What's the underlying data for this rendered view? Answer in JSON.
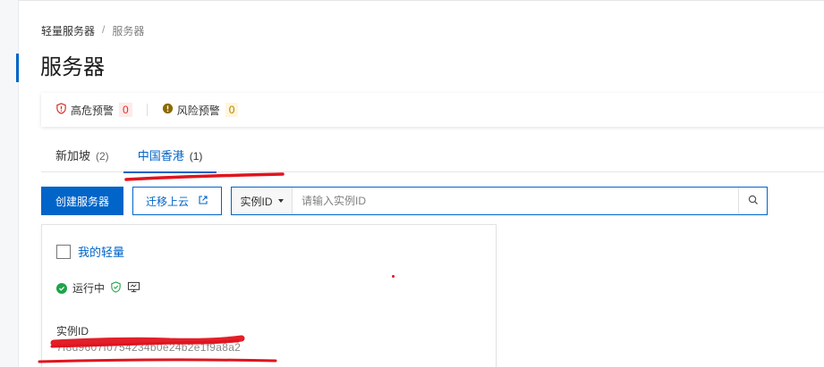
{
  "breadcrumb": {
    "root": "轻量服务器",
    "separator": "/",
    "current": "服务器"
  },
  "page": {
    "title": "服务器"
  },
  "alerts": {
    "high": {
      "label": "高危预警",
      "count": "0"
    },
    "risk": {
      "label": "风险预警",
      "count": "0"
    }
  },
  "tabs": [
    {
      "label": "新加坡",
      "count": "(2)"
    },
    {
      "label": "中国香港",
      "count": "(1)"
    }
  ],
  "toolbar": {
    "create_label": "创建服务器",
    "migrate_label": "迁移上云",
    "search": {
      "selected": "实例ID",
      "placeholder": "请输入实例ID"
    }
  },
  "instance": {
    "name": "我的轻量",
    "status": "运行中",
    "id_label": "实例ID",
    "id_value": "7f8d9607f0754234b0e24b2e1f9a8a2"
  },
  "colors": {
    "brand": "#0064c8",
    "success": "#1ea34a",
    "danger": "#d93026",
    "warning": "#b57f00",
    "annotation": "#e0141e"
  },
  "icons": {
    "high_alert": "shield-alert-icon",
    "risk_alert": "warning-circle-icon",
    "search": "search-icon",
    "external": "external-link-icon",
    "shield": "shield-check-icon",
    "monitor": "monitor-icon"
  }
}
